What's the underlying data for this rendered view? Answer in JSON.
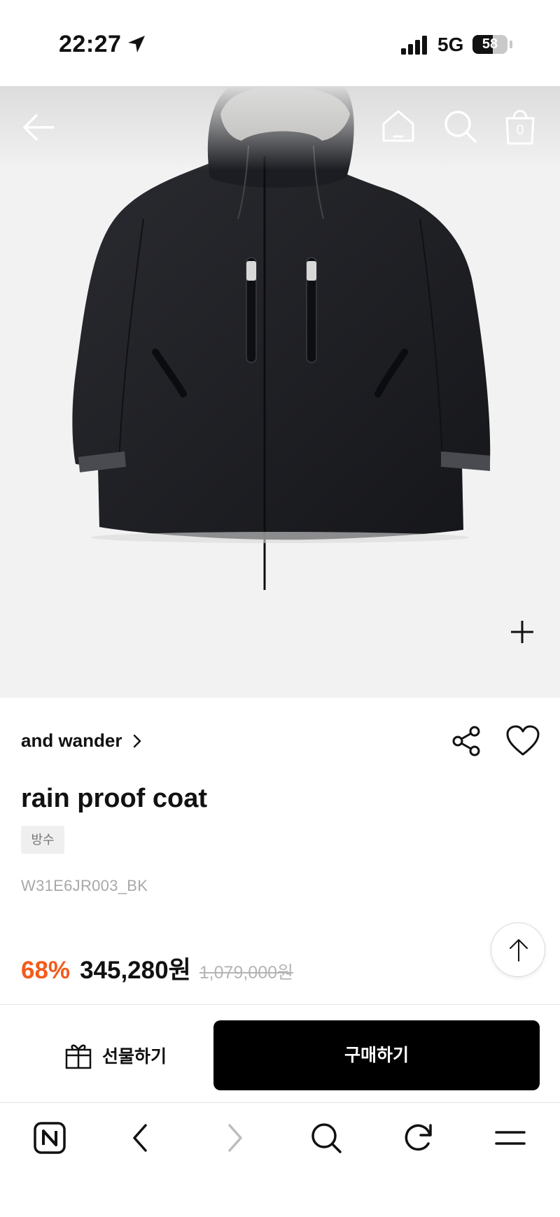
{
  "status_bar": {
    "time": "22:27",
    "network": "5G",
    "battery_percent": "58",
    "battery_level": 0.58
  },
  "header": {
    "back_icon": "arrow-left-icon",
    "home_icon": "home-icon",
    "search_icon": "search-icon",
    "cart_icon": "shopping-bag-icon",
    "cart_count": "0"
  },
  "product": {
    "brand": "and wander",
    "title": "rain proof coat",
    "tag": "방수",
    "sku": "W31E6JR003_BK",
    "discount": "68%",
    "price": "345,280원",
    "original_price": "1,079,000원",
    "accent_color": "#f35b1c"
  },
  "actions": {
    "gift_label": "선물하기",
    "buy_label": "구매하기"
  },
  "browser_toolbar": {
    "items": [
      "naver-home-icon",
      "back-icon",
      "forward-icon",
      "search-icon",
      "reload-icon",
      "menu-icon"
    ]
  }
}
